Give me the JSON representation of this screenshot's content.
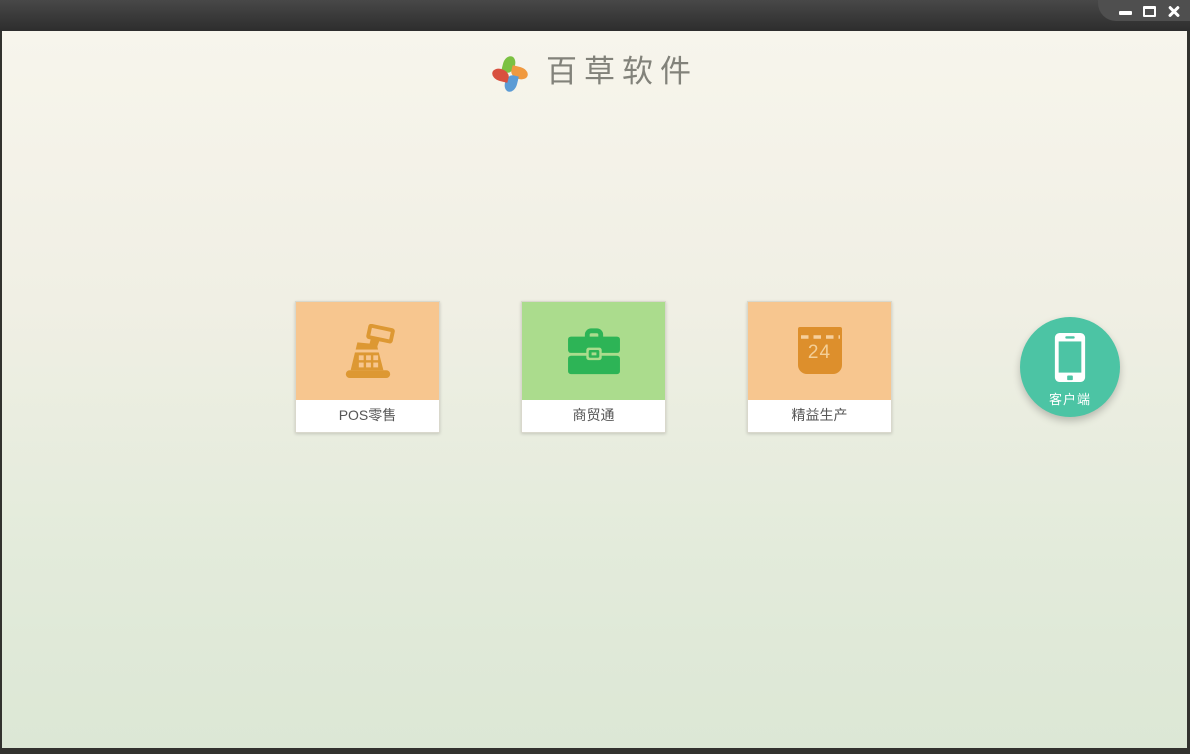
{
  "window": {
    "controls": {
      "minimize_icon": "minimize-icon",
      "maximize_icon": "maximize-icon",
      "close_icon": "close-icon"
    },
    "frame_color": "#32322e",
    "titlebar_gradient": [
      "#484848",
      "#2d2d2d"
    ]
  },
  "header": {
    "app_title": "百草软件",
    "logo_icon": "pinwheel-logo-icon",
    "logo_petal_colors": {
      "top": "#7bc142",
      "right": "#f0993f",
      "bottom": "#5b9bd5",
      "left": "#d8503f"
    }
  },
  "products": [
    {
      "label": "POS零售",
      "icon": "cash-register-icon",
      "tile_color": "#f7c68f",
      "icon_color": "#dd9833"
    },
    {
      "label": "商贸通",
      "icon": "briefcase-icon",
      "tile_color": "#abdc8d",
      "icon_color": "#2db456"
    },
    {
      "label": "精益生产",
      "icon": "calendar-icon",
      "calendar_day": "24",
      "tile_color": "#f7c68f",
      "icon_color": "#dd8f2c"
    }
  ],
  "client_button": {
    "label": "客户端",
    "icon": "smartphone-icon",
    "color": "#4cc4a4"
  },
  "background": {
    "top_color": "#f7f5ec",
    "bottom_color": "#dce7d5"
  }
}
